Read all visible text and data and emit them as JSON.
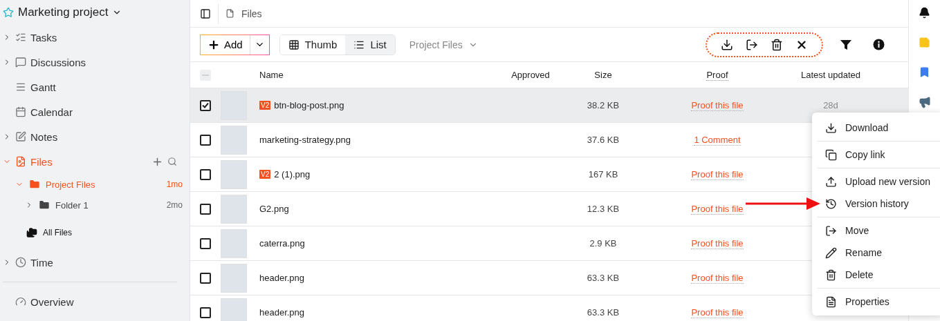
{
  "sidebar": {
    "project_title": "Marketing project",
    "items": [
      {
        "label": "Tasks",
        "expanded": false,
        "selected": false
      },
      {
        "label": "Discussions",
        "expanded": false,
        "selected": false
      },
      {
        "label": "Gantt",
        "selected": false
      },
      {
        "label": "Calendar",
        "selected": false
      },
      {
        "label": "Notes",
        "expanded": false,
        "selected": false
      },
      {
        "label": "Files",
        "expanded": true,
        "selected": true,
        "children": [
          {
            "label": "Project Files",
            "time": "1mo",
            "selected": true,
            "expanded": true,
            "children": [
              {
                "label": "Folder 1",
                "time": "2mo",
                "selected": false,
                "expanded": false
              }
            ]
          }
        ],
        "extra": "All Files"
      },
      {
        "label": "Time",
        "expanded": false,
        "selected": false
      }
    ],
    "footer_item": "Overview"
  },
  "breadcrumb": "Files",
  "toolbar": {
    "add_label": "Add",
    "views": [
      {
        "label": "Thumb",
        "selected": false
      },
      {
        "label": "List",
        "selected": true
      }
    ],
    "folder_select": "Project Files"
  },
  "table": {
    "columns": [
      "Name",
      "Approved",
      "Size",
      "Proof",
      "Latest updated"
    ],
    "all_checked": false,
    "rows": [
      {
        "checked": true,
        "version": "V2",
        "name": "btn-blog-post.png",
        "size": "38.2 KB",
        "proof": "Proof this file",
        "updated": "28d"
      },
      {
        "checked": false,
        "name": "marketing-strategy.png",
        "size": "37.6 KB",
        "proof": "1 Comment"
      },
      {
        "checked": false,
        "version": "V2",
        "name": "2 (1).png",
        "size": "167 KB",
        "proof": "Proof this file"
      },
      {
        "checked": false,
        "name": "G2.png",
        "size": "12.3 KB",
        "proof": "Proof this file"
      },
      {
        "checked": false,
        "name": "caterra.png",
        "size": "2.9 KB",
        "proof": "Proof this file"
      },
      {
        "checked": false,
        "name": "header.png",
        "size": "63.3 KB",
        "proof": "Proof this file"
      },
      {
        "checked": false,
        "name": "header.png",
        "size": "63.3 KB",
        "proof": "Proof this file"
      }
    ]
  },
  "context_menu": {
    "groups": [
      [
        "Download"
      ],
      [
        "Copy link"
      ],
      [
        "Upload new version",
        "Version history"
      ],
      [
        "Move",
        "Rename",
        "Delete"
      ],
      [
        "Properties"
      ]
    ]
  }
}
